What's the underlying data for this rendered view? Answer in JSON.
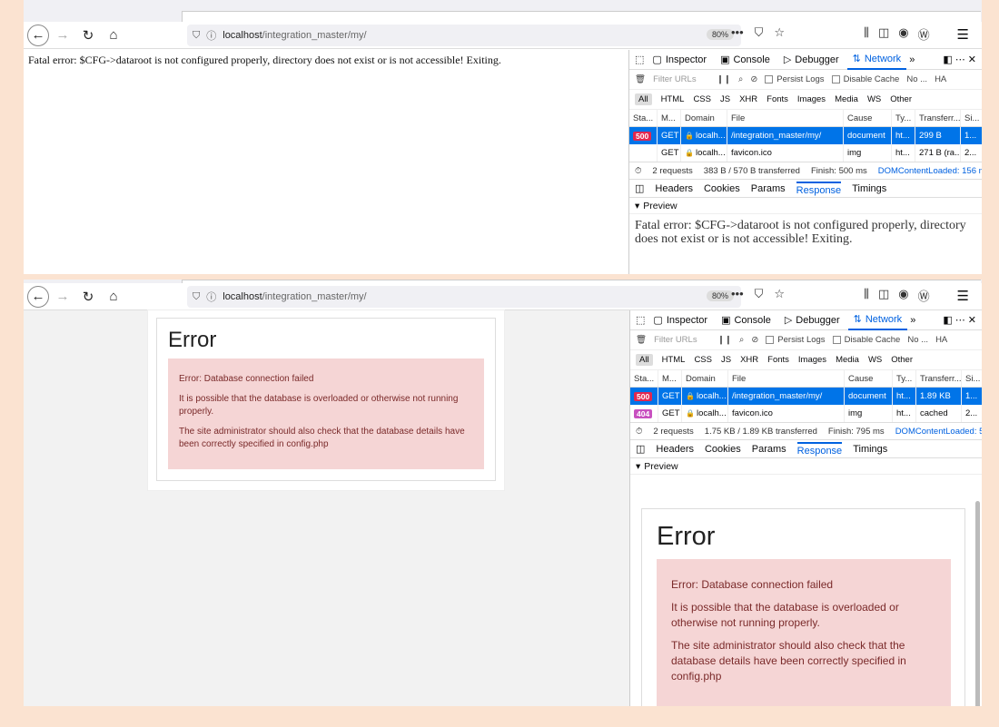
{
  "browser": {
    "url_host": "localhost",
    "url_path": "/integration_master/my/",
    "zoom": "80%",
    "more_icon": "•••",
    "back_icon": "arrow-left",
    "forward_icon": "arrow-right",
    "reload_icon": "reload",
    "home_icon": "home"
  },
  "devtools": {
    "tabs": [
      "Inspector",
      "Console",
      "Debugger",
      "Network"
    ],
    "active_tab": "Network",
    "filter_placeholder": "Filter URLs",
    "persist_logs": "Persist Logs",
    "disable_cache": "Disable Cache",
    "throttle": "No ...",
    "har": "HA",
    "types": [
      "All",
      "HTML",
      "CSS",
      "JS",
      "XHR",
      "Fonts",
      "Images",
      "Media",
      "WS",
      "Other"
    ],
    "columns": [
      "Sta...",
      "M...",
      "Domain",
      "File",
      "Cause",
      "Ty...",
      "Transferr...",
      "Si..."
    ],
    "detail_tabs": [
      "Headers",
      "Cookies",
      "Params",
      "Response",
      "Timings"
    ],
    "preview_label": "Preview"
  },
  "shot1": {
    "page_text": "Fatal error: $CFG->dataroot is not configured properly, directory does not exist or is not accessible! Exiting.",
    "rows": [
      {
        "status": "500",
        "method": "GET",
        "domain": "localh...",
        "file": "/integration_master/my/",
        "cause": "document",
        "type": "ht...",
        "transferred": "299 B",
        "size": "1..."
      },
      {
        "status": "",
        "method": "GET",
        "domain": "localh...",
        "file": "favicon.ico",
        "cause": "img",
        "type": "ht...",
        "transferred": "271 B (ra...",
        "size": "2..."
      }
    ],
    "summary": {
      "requests": "2 requests",
      "transferred": "383 B / 570 B transferred",
      "finish": "Finish: 500 ms",
      "dcl": "DOMContentLoaded: 156 m"
    },
    "preview_text": "Fatal error: $CFG->dataroot is not configured properly, directory does not exist or is not accessible! Exiting."
  },
  "shot2": {
    "rows": [
      {
        "status": "500",
        "method": "GET",
        "domain": "localh...",
        "file": "/integration_master/my/",
        "cause": "document",
        "type": "ht...",
        "transferred": "1.89 KB",
        "size": "1..."
      },
      {
        "status": "404",
        "method": "GET",
        "domain": "localh...",
        "file": "favicon.ico",
        "cause": "img",
        "type": "ht...",
        "transferred": "cached",
        "size": "2..."
      }
    ],
    "summary": {
      "requests": "2 requests",
      "transferred": "1.75 KB / 1.89 KB transferred",
      "finish": "Finish: 795 ms",
      "dcl": "DOMContentLoaded: 5"
    },
    "error": {
      "title": "Error",
      "line1": "Error: Database connection failed",
      "line2": "It is possible that the database is overloaded or otherwise not running properly.",
      "line3": "The site administrator should also check that the database details have been correctly specified in config.php"
    }
  }
}
